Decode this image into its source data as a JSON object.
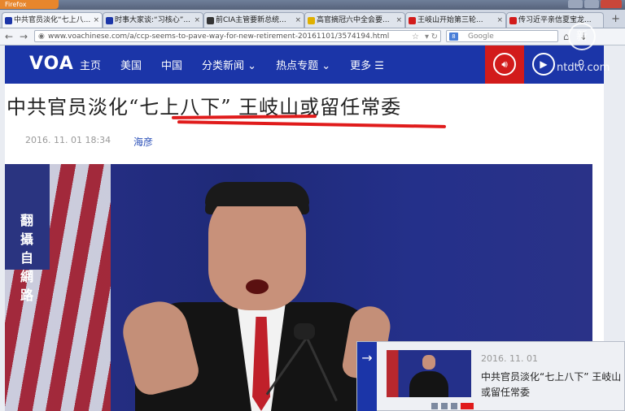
{
  "browser": {
    "app_button": "Firefox",
    "tabs": [
      {
        "label": "中共官员淡化“七上八...",
        "fav_color": "#1b35a8",
        "active": true
      },
      {
        "label": "时事大家谈:“习核心”...",
        "fav_color": "#1b35a8",
        "active": false
      },
      {
        "label": "前CIA主管要新总统...",
        "fav_color": "#333333",
        "active": false
      },
      {
        "label": "高官摘冠六中全会要...",
        "fav_color": "#e0b000",
        "active": false
      },
      {
        "label": "王岐山开始第三轮...",
        "fav_color": "#d21b1b",
        "active": false
      },
      {
        "label": "传习近平亲信夏宝龙...",
        "fav_color": "#d21b1b",
        "active": false
      }
    ],
    "new_tab": "+",
    "url": "www.voachinese.com/a/ccp-seems-to-pave-way-for-new-retirement-20161101/3574194.html",
    "search_placeholder": "Google",
    "search_engine_badge": "8"
  },
  "site": {
    "logo": "VOA",
    "menu": [
      "主页",
      "美国",
      "中国",
      "分类新闻 ⌄",
      "热点专题 ⌄",
      "更多 ☰"
    ],
    "brand_color": "#1b35a8",
    "audio_color": "#d21b1b"
  },
  "article": {
    "headline": "中共官员淡化“七上八下” 王岐山或留任常委",
    "date": "2016. 11. 01  18:34",
    "author": "海彦",
    "watermark_chars": [
      "翻",
      "攝",
      "自",
      "網",
      "路"
    ]
  },
  "popup": {
    "date": "2016. 11. 01",
    "title": "中共官员淡化“七上八下” 王岐山或留任常委"
  },
  "overlay": {
    "ntd_logo": "新",
    "ntd_text": "ntdtv.com"
  }
}
